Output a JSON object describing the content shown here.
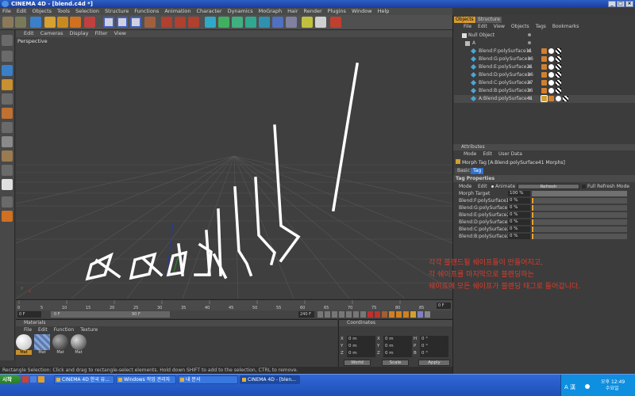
{
  "window": {
    "title": "CINEMA 4D - [blend.c4d *]"
  },
  "menubar": [
    "File",
    "Edit",
    "Objects",
    "Tools",
    "Selection",
    "Structure",
    "Functions",
    "Animation",
    "Character",
    "Dynamics",
    "MoGraph",
    "Hair",
    "Render",
    "Plugins",
    "Window",
    "Help"
  ],
  "viewport": {
    "menu": [
      "Edit",
      "Cameras",
      "Display",
      "Filter",
      "View"
    ],
    "label": "Perspective"
  },
  "timeline": {
    "ticks": [
      "0",
      "5",
      "10",
      "15",
      "20",
      "25",
      "30",
      "35",
      "40",
      "45",
      "50",
      "55",
      "60",
      "65",
      "70",
      "75",
      "80",
      "85",
      "90"
    ],
    "end_frame": "0 F",
    "start_field": "0 F",
    "current_field": "0 F",
    "range_field": "90 F",
    "max_field": "240 F"
  },
  "materials": {
    "title": "Materials",
    "menu": [
      "File",
      "Edit",
      "Function",
      "Texture"
    ],
    "items": [
      "Mat",
      "Mat",
      "Mat",
      "Mat"
    ]
  },
  "coordinates": {
    "title": "Coordinates",
    "rows": [
      {
        "a": "X",
        "av": "0 m",
        "b": "X",
        "bv": "0 m",
        "c": "H",
        "cv": "0 °"
      },
      {
        "a": "Y",
        "av": "0 m",
        "b": "Y",
        "bv": "0 m",
        "c": "P",
        "cv": "0 °"
      },
      {
        "a": "Z",
        "av": "0 m",
        "b": "Z",
        "bv": "0 m",
        "c": "B",
        "cv": "0 °"
      }
    ],
    "mode1": "World",
    "mode2": "Scale",
    "apply": "Apply"
  },
  "status": "Rectangle Selection: Click and drag to rectangle-select elements. Hold down SHIFT to add to the selection, CTRL to remove.",
  "objects": {
    "tabs": [
      "Objects",
      "Structure"
    ],
    "menu": [
      "File",
      "Edit",
      "View",
      "Objects",
      "Tags",
      "Bookmarks"
    ],
    "rows": [
      "Null Object",
      "A",
      "Blend:F:polySurface11",
      "Blend:G:polySurface16",
      "Blend:E:polySurface21",
      "Blend:D:polySurface26",
      "Blend:C:polySurface27",
      "Blend:B:polySurface36",
      "A:Blend:polySurface41"
    ]
  },
  "attributes": {
    "title": "Attributes",
    "menu": [
      "Mode",
      "Edit",
      "User Data"
    ],
    "heading": "Morph Tag [A:Blend:polySurface41 Morphs]",
    "tabs": [
      "Basic",
      "Tag"
    ],
    "section": "Tag Properties",
    "mode_row": {
      "mode": "Mode",
      "edit": "Edit",
      "animate": "Animate",
      "refresh": "Refresh",
      "full_refresh": "Full Refresh Mode"
    },
    "target_label": "Morph Target",
    "target_value": "100 %",
    "props": [
      {
        "label": "Blend:F:polySurface11",
        "value": "0 %"
      },
      {
        "label": "Blend:G:polySurface16",
        "value": "0 %"
      },
      {
        "label": "Blend:E:polySurface21",
        "value": "0 %"
      },
      {
        "label": "Blend:D:polySurface26",
        "value": "0 %"
      },
      {
        "label": "Blend:C:polySurface27",
        "value": "0 %"
      },
      {
        "label": "Blend:B:polySurface36",
        "value": "0 %"
      }
    ]
  },
  "annotation": [
    "각각 블렌드될 쉐이프들이 만들어지고,",
    "각 쉐이프를 마지막으로 블렌딩하는",
    "쉐이프에 모든 쉐이프가 블렌딩 태그로 들어갑니다."
  ],
  "taskbar": {
    "start": "시작",
    "tasks": [
      "CINEMA 4D 한국 유...",
      "Windows 작업 관리자",
      "내 문서",
      "CINEMA 4D - [blen..."
    ],
    "clock": "오후 12:49",
    "day": "수요일",
    "ime": "A 漢"
  }
}
